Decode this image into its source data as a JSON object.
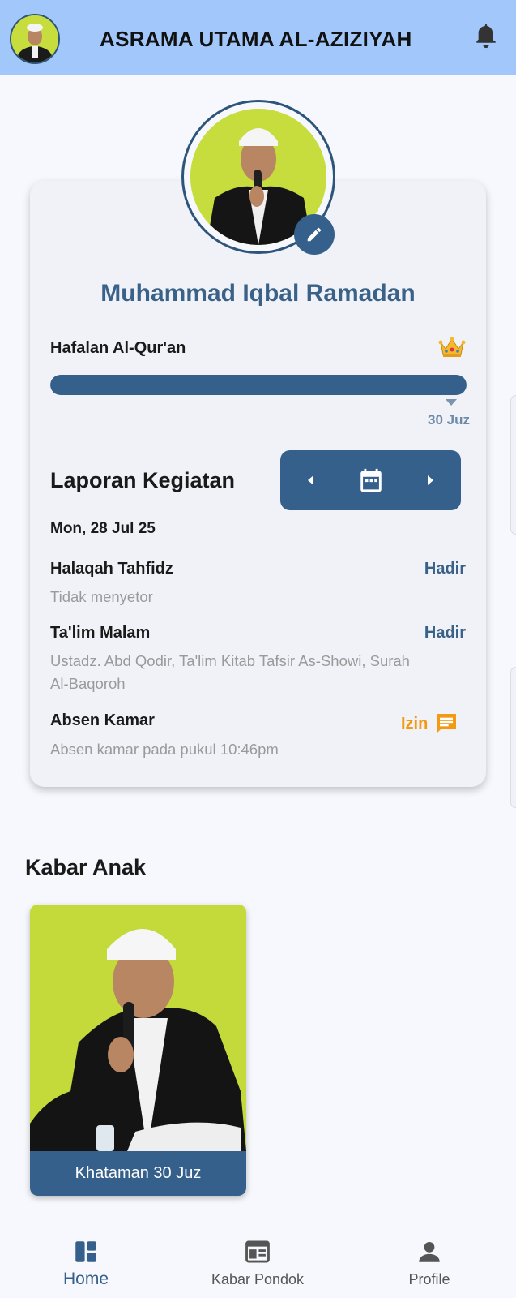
{
  "header": {
    "title": "ASRAMA UTAMA AL-AZIZIYAH",
    "avatar_icon": "student-avatar",
    "bell_icon": "bell-icon"
  },
  "profile": {
    "name": "Muhammad Iqbal Ramadan",
    "edit_icon": "pencil-icon"
  },
  "hafalan": {
    "label": "Hafalan Al-Qur'an",
    "progress_juz": 30,
    "progress_max_juz": 30,
    "progress_label": "30 Juz",
    "badge_icon": "crown-icon"
  },
  "laporan": {
    "title": "Laporan Kegiatan",
    "date": "Mon, 28 Jul 25",
    "activities": [
      {
        "name": "Halaqah Tahfidz",
        "status": "Hadir",
        "desc": "Tidak menyetor"
      },
      {
        "name": "Ta'lim Malam",
        "status": "Hadir",
        "desc": "Ustadz. Abd Qodir, Ta'lim Kitab Tafsir As-Showi, Surah Al-Baqoroh"
      },
      {
        "name": "Absen Kamar",
        "status": "Izin",
        "desc": "Absen kamar pada pukul 10:46pm"
      }
    ]
  },
  "kabar_anak": {
    "title": "Kabar Anak",
    "items": [
      {
        "caption": "Khataman 30 Juz"
      }
    ]
  },
  "bottom_nav": [
    {
      "label": "Home",
      "icon": "dashboard-icon",
      "active": true
    },
    {
      "label": "Kabar Pondok",
      "icon": "news-icon",
      "active": false
    },
    {
      "label": "Profile",
      "icon": "person-icon",
      "active": false
    }
  ],
  "colors": {
    "header_bg": "#a2c8fb",
    "primary": "#35608b",
    "status_hadir": "#3a6288",
    "status_izin": "#f39a12"
  }
}
